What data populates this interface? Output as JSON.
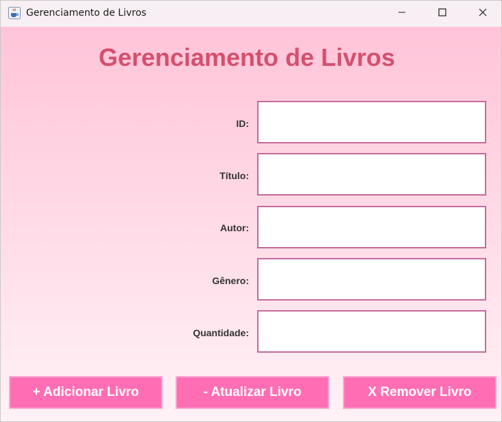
{
  "window": {
    "title": "Gerenciamento de Livros",
    "icon": "java-coffee-cup-icon",
    "controls": [
      "minimize-icon",
      "maximize-icon",
      "close-icon"
    ]
  },
  "form": {
    "heading": "Gerenciamento de Livros",
    "fields": [
      {
        "label": "ID:",
        "value": "",
        "placeholder": ""
      },
      {
        "label": "Título:",
        "value": "",
        "placeholder": ""
      },
      {
        "label": "Autor:",
        "value": "",
        "placeholder": ""
      },
      {
        "label": "Gênero:",
        "value": "",
        "placeholder": ""
      },
      {
        "label": "Quantidade:",
        "value": "",
        "placeholder": ""
      }
    ]
  },
  "actions": {
    "add_label": "+ Adicionar Livro",
    "update_label": "- Atualizar Livro",
    "remove_label": "X Remover Livro"
  },
  "colors": {
    "heading": "#d4506e",
    "button_bg": "#ff6eb4",
    "button_border": "#ffa6d0",
    "input_border": "#c4699a",
    "background_top": "#ffc4d9",
    "background_bottom": "#fff2f6",
    "titlebar": "#f7eff3"
  }
}
